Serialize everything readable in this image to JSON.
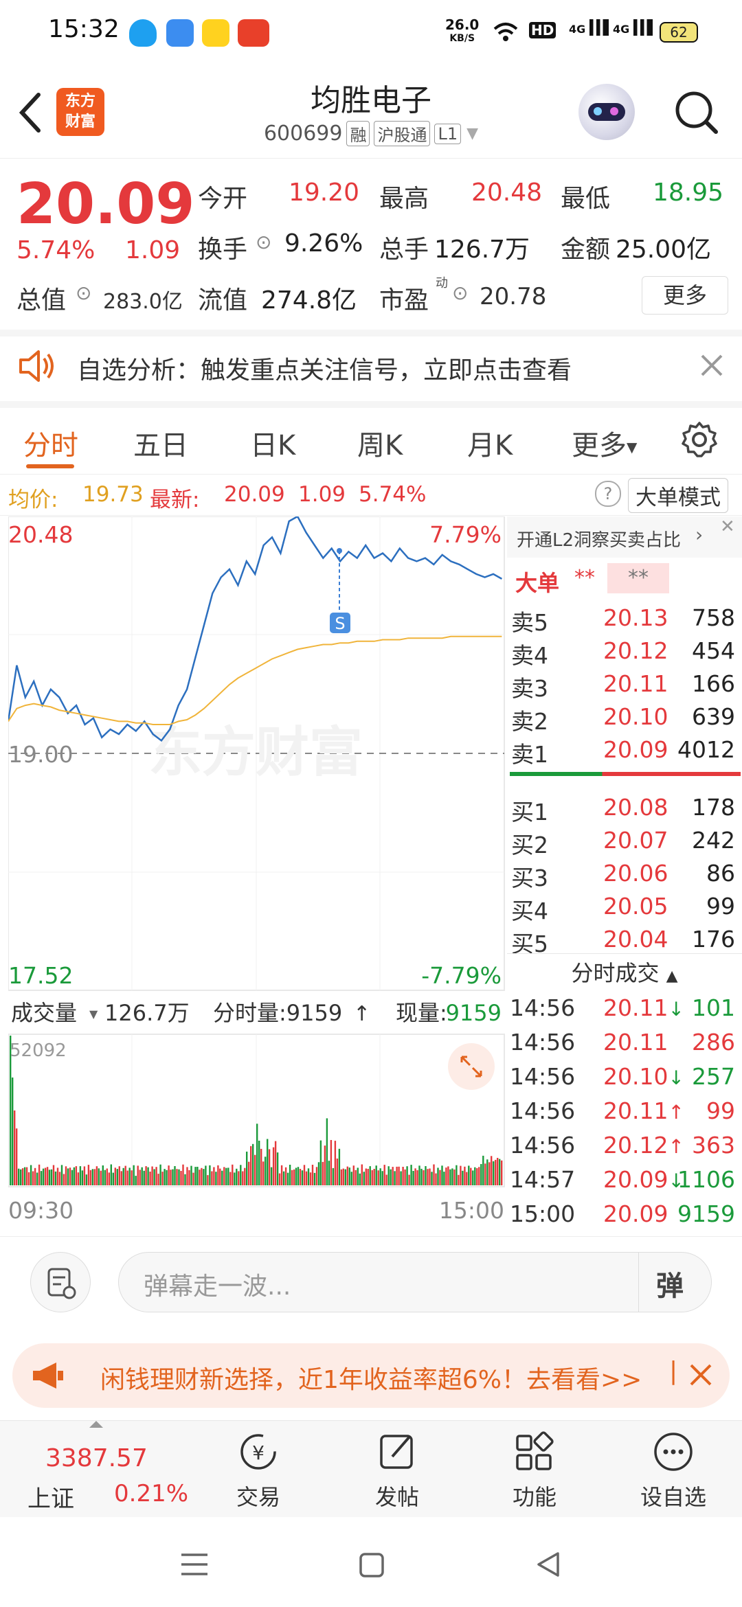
{
  "status_bar": {
    "time": "15:32",
    "net_speed": "26.0",
    "net_unit": "KB/S",
    "hd": "HD",
    "sig1": "4G",
    "sig2": "4G",
    "battery": "62"
  },
  "header": {
    "logo_line1": "东方",
    "logo_line2": "财富",
    "stock_name": "均胜电子",
    "stock_code": "600699",
    "tags": [
      "融",
      "沪股通",
      "L1"
    ]
  },
  "quote": {
    "last_price": "20.09",
    "change_pct": "5.74%",
    "change": "1.09",
    "open_label": "今开",
    "open": "19.20",
    "high_label": "最高",
    "high": "20.48",
    "low_label": "最低",
    "low": "18.95",
    "turnover_label": "换手",
    "turnover": "9.26%",
    "volume_label": "总手",
    "volume": "126.7万",
    "amount_label": "金额",
    "amount": "25.00亿",
    "mktcap_label": "总值",
    "mktcap": "283.0亿",
    "float_label": "流值",
    "float_cap": "274.8亿",
    "pe_label": "市盈",
    "pe_sup": "动",
    "pe": "20.78",
    "more_label": "更多"
  },
  "alert": {
    "text": "自选分析：触发重点关注信号，立即点击查看"
  },
  "tabs": [
    "分时",
    "五日",
    "日K",
    "周K",
    "月K",
    "更多"
  ],
  "info_bar": {
    "avg_label": "均价:",
    "avg": "19.73",
    "latest_label": "最新:",
    "latest": "20.09",
    "chg": "1.09",
    "chg_pct": "5.74%",
    "mode_label": "大单模式"
  },
  "chart_labels": {
    "top_price": "20.48",
    "top_pct": "7.79%",
    "ref_price": "19.00",
    "bottom_price": "17.52",
    "bottom_pct": "-7.79%",
    "watermark": "东方财富",
    "signal": "S",
    "vol_label": "成交量",
    "vol_total": "126.7万",
    "tick_vol_label": "分时量:9159",
    "cur_vol_label": "现量:",
    "cur_vol": "9159",
    "vol_max": "52092",
    "time_start": "09:30",
    "time_end": "15:00"
  },
  "chart_data": {
    "type": "line",
    "xlabel": "",
    "ylabel": "",
    "time_range": [
      "09:30",
      "15:00"
    ],
    "ylim": [
      17.52,
      20.48
    ],
    "prev_close": 19.0,
    "series": [
      {
        "values": [
          19.2,
          19.55,
          19.35,
          19.45,
          19.3,
          19.4,
          19.35,
          19.25,
          19.3,
          19.18,
          19.22,
          19.1,
          19.15,
          19.12,
          19.18,
          19.14,
          19.2,
          19.12,
          19.08,
          19.15,
          19.3,
          19.4,
          19.6,
          19.8,
          20.0,
          20.1,
          20.15,
          20.05,
          20.2,
          20.12,
          20.3,
          20.35,
          20.25,
          20.45,
          20.48,
          20.38,
          20.3,
          20.22,
          20.28,
          20.2,
          20.26,
          20.22,
          20.3,
          20.22,
          20.25,
          20.2,
          20.28,
          20.22,
          20.2,
          20.22,
          20.18,
          20.24,
          20.2,
          20.18,
          20.15,
          20.12,
          20.1,
          20.12,
          20.09
        ]
      },
      {
        "values": [
          19.2,
          19.28,
          19.3,
          19.31,
          19.3,
          19.29,
          19.27,
          19.26,
          19.25,
          19.24,
          19.23,
          19.22,
          19.21,
          19.2,
          19.2,
          19.19,
          19.19,
          19.18,
          19.18,
          19.18,
          19.2,
          19.21,
          19.24,
          19.28,
          19.33,
          19.38,
          19.43,
          19.47,
          19.5,
          19.53,
          19.56,
          19.59,
          19.61,
          19.63,
          19.65,
          19.66,
          19.67,
          19.68,
          19.68,
          19.69,
          19.69,
          19.7,
          19.7,
          19.7,
          19.71,
          19.71,
          19.71,
          19.72,
          19.72,
          19.72,
          19.72,
          19.72,
          19.73,
          19.73,
          19.73,
          19.73,
          19.73,
          19.73,
          19.73
        ]
      }
    ],
    "volume_max": 52092
  },
  "l2": {
    "banner": "开通L2洞察买卖占比",
    "big_label": "大单",
    "big_a": "**",
    "big_b": "**"
  },
  "order_book": {
    "asks": [
      {
        "label": "卖5",
        "price": "20.13",
        "vol": "758"
      },
      {
        "label": "卖4",
        "price": "20.12",
        "vol": "454"
      },
      {
        "label": "卖3",
        "price": "20.11",
        "vol": "166"
      },
      {
        "label": "卖2",
        "price": "20.10",
        "vol": "639"
      },
      {
        "label": "卖1",
        "price": "20.09",
        "vol": "4012"
      }
    ],
    "bids": [
      {
        "label": "买1",
        "price": "20.08",
        "vol": "178"
      },
      {
        "label": "买2",
        "price": "20.07",
        "vol": "242"
      },
      {
        "label": "买3",
        "price": "20.06",
        "vol": "86"
      },
      {
        "label": "买4",
        "price": "20.05",
        "vol": "99"
      },
      {
        "label": "买5",
        "price": "20.04",
        "vol": "176"
      }
    ]
  },
  "trades": {
    "title": "分时成交",
    "rows": [
      {
        "time": "14:56",
        "price": "20.11",
        "arrow": "↓",
        "vol": "101"
      },
      {
        "time": "14:56",
        "price": "20.11",
        "arrow": "",
        "vol": "286"
      },
      {
        "time": "14:56",
        "price": "20.10",
        "arrow": "↓",
        "vol": "257"
      },
      {
        "time": "14:56",
        "price": "20.11",
        "arrow": "↑",
        "vol": "99"
      },
      {
        "time": "14:56",
        "price": "20.12",
        "arrow": "↑",
        "vol": "363"
      },
      {
        "time": "14:57",
        "price": "20.09",
        "arrow": "↓",
        "vol": "1106"
      },
      {
        "time": "15:00",
        "price": "20.09",
        "arrow": "",
        "vol": "9159"
      }
    ]
  },
  "danmu": {
    "placeholder": "弹幕走一波...",
    "send_label": "弹"
  },
  "ad": {
    "text": "闲钱理财新选择，近1年收益率超6%！去看看>>"
  },
  "bottom_bar": {
    "index_value": "3387.57",
    "index_name": "上证",
    "index_pct": "0.21%",
    "items": [
      "交易",
      "发帖",
      "功能",
      "设自选"
    ]
  }
}
